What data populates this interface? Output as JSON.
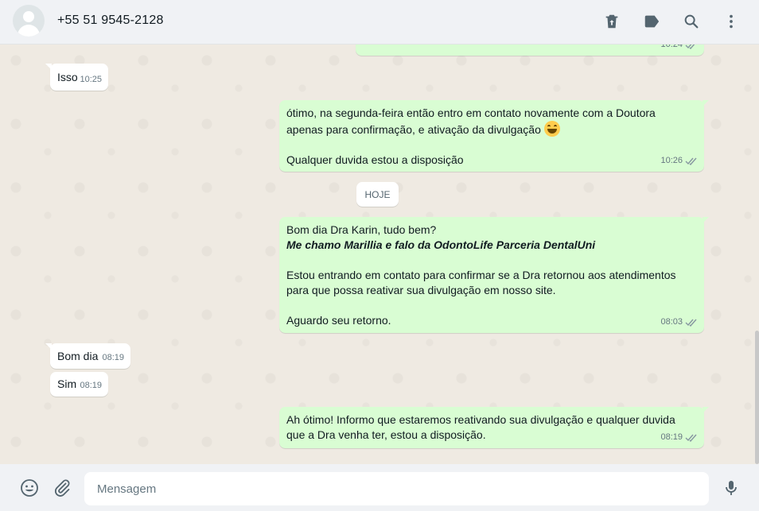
{
  "header": {
    "contact_name": "+55 51 9545-2128",
    "icons": [
      "delete-icon",
      "label-icon",
      "search-icon",
      "menu-icon"
    ]
  },
  "messages": [
    {
      "dir": "out",
      "time": "10:24",
      "text": ""
    },
    {
      "dir": "in",
      "time": "10:25",
      "text": "Isso"
    },
    {
      "dir": "out",
      "time": "10:26",
      "text_line1": "ótimo, na segunda-feira então entro em contato novamente com a Doutora",
      "text_line2": "apenas para confirmação, e ativação da divulgação",
      "emoji": "grinning-face-emoji",
      "text_line3": "Qualquer duvida estou a disposição"
    },
    {
      "dir": "out",
      "time": "08:03",
      "text_line1": "Bom dia Dra Karin, tudo bem?",
      "text_bold": "Me chamo Marillia e falo da OdontoLife Parceria DentalUni",
      "text_line2": "Estou entrando em contato para confirmar se a Dra retornou aos atendimentos",
      "text_line3": "para que possa reativar sua divulgação em nosso site.",
      "text_line4": "Aguardo seu retorno."
    },
    {
      "dir": "in",
      "time": "08:19",
      "text": "Bom dia"
    },
    {
      "dir": "in",
      "time": "08:19",
      "text": "Sim"
    },
    {
      "dir": "out",
      "time": "08:19",
      "text_line1": "Ah ótimo! Informo que estaremos reativando sua divulgação e qualquer duvida",
      "text_line2": "que a Dra venha ter, estou a disposição."
    }
  ],
  "date_divider": "HOJE",
  "footer": {
    "placeholder": "Mensagem",
    "icons": [
      "emoji-icon",
      "attach-icon",
      "mic-icon"
    ]
  },
  "colors": {
    "outgoing_bubble": "#d9fdd3",
    "incoming_bubble": "#ffffff",
    "chat_background": "#efeae2",
    "header_background": "#f0f2f5"
  }
}
